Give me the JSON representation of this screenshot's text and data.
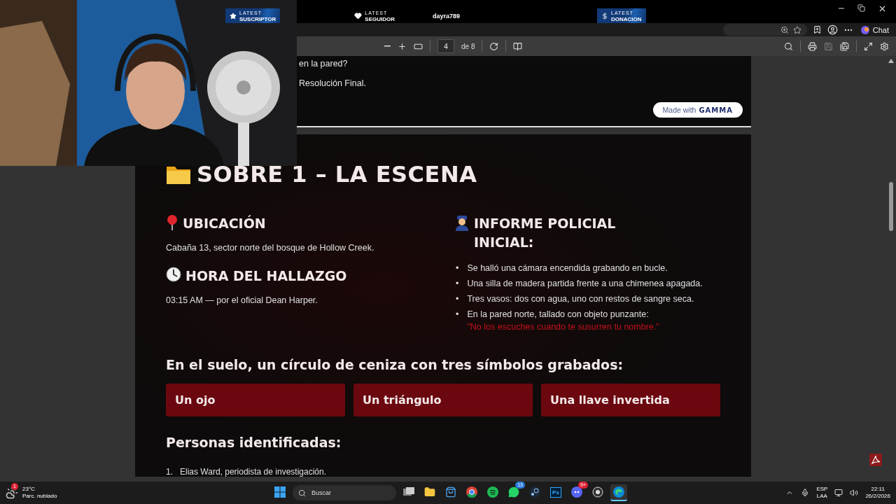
{
  "stream_overlay": {
    "alerts": [
      {
        "kind": "star",
        "label_top": "LATEST",
        "label": "SUSCRIPTOR"
      },
      {
        "kind": "heart",
        "label_top": "LATEST",
        "label": "SEGUIDOR",
        "name": "dayra789"
      },
      {
        "kind": "dollar",
        "label_top": "LATEST",
        "label": "DONACION"
      }
    ]
  },
  "browser": {
    "chat_button": "Chat"
  },
  "pdf_toolbar": {
    "page": "4",
    "page_count": "de 8"
  },
  "previous_page": {
    "lines": [
      "en la pared?",
      "Resolución Final."
    ],
    "badge": {
      "prefix": "Made with",
      "brand": "GAMMA"
    }
  },
  "page": {
    "title": "SOBRE 1 – LA ESCENA",
    "left_sections": [
      {
        "kind": "location",
        "heading": "UBICACIÓN",
        "text": "Cabaña 13, sector norte del bosque de Hollow Creek."
      },
      {
        "kind": "time",
        "heading": "HORA DEL HALLAZGO",
        "text": "03:15 AM — por el oficial Dean Harper."
      }
    ],
    "report": {
      "kind": "police",
      "heading": "INFORME POLICIAL INICIAL:",
      "bullets": [
        {
          "marker": "•",
          "text": "Se halló una cámara encendida grabando en bucle."
        },
        {
          "marker": "•",
          "text": "Una silla de madera partida frente a una chimenea apagada."
        },
        {
          "marker": "•",
          "text": "Tres vasos: dos con agua, uno con restos de sangre seca."
        },
        {
          "marker": "•",
          "text": "En la pared norte, tallado con objeto punzante:",
          "quote": "\"No los escuches cuando te susurren tu nombre.\""
        }
      ]
    },
    "symbols_heading": "En el suelo, un círculo de ceniza con tres símbolos grabados:",
    "symbols": [
      "Un ojo",
      "Un triángulo",
      "Una llave invertida"
    ],
    "people_heading": "Personas identificadas:",
    "people": [
      {
        "number": "1.",
        "text": "Elias Ward, periodista de investigación."
      }
    ]
  },
  "taskbar": {
    "weather": {
      "temp": "23°C",
      "condition": "Parc. nublado",
      "badge": "1"
    },
    "search": {
      "placeholder": "Buscar"
    },
    "apps": [
      {
        "kind": "taskview",
        "selected": false
      },
      {
        "kind": "folder",
        "selected": false
      },
      {
        "kind": "store",
        "selected": false
      },
      {
        "kind": "chrome",
        "selected": false
      },
      {
        "kind": "spotify",
        "selected": false
      },
      {
        "kind": "whatsapp",
        "selected": false,
        "badge": "13"
      },
      {
        "kind": "steam",
        "selected": false
      },
      {
        "kind": "photoshop",
        "selected": false,
        "label": "Ps"
      },
      {
        "kind": "discord",
        "selected": false,
        "badge": "9+"
      },
      {
        "kind": "obs",
        "selected": false
      },
      {
        "kind": "edge",
        "selected": true
      }
    ],
    "language": "ESP",
    "layout": "LAA",
    "time": "22:11",
    "date": "26/2/2026"
  }
}
